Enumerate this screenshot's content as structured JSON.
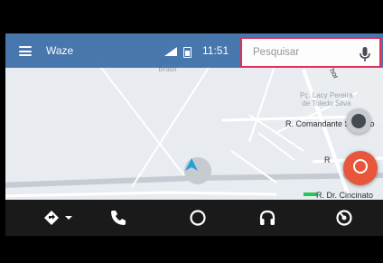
{
  "app": {
    "title": "Waze",
    "time": "11:51"
  },
  "search": {
    "placeholder": "Pesquisar"
  },
  "map": {
    "labels": {
      "toyota": "Toyota do\nBrasil",
      "plaza": "Pç. Lacy Pereira\nde Toledo Silva",
      "comandante": "R. Comandante Salgado",
      "rua_partial": "R",
      "rua_suffix": "ce",
      "cincinato": "R. Dr. Cincinato",
      "rua_top": "hor"
    }
  },
  "icons": {
    "menu": "menu-icon",
    "signal": "cell-signal-icon",
    "battery": "battery-icon",
    "mic": "mic-icon",
    "compass": "compass-icon",
    "report": "report-icon",
    "location": "current-location-arrow-icon",
    "nav": "navigation-icon",
    "phone": "phone-icon",
    "home": "home-icon",
    "audio": "headphones-icon",
    "notifications": "notifications-icon"
  },
  "colors": {
    "topbar": "#3a6ea8",
    "search_border": "#e0204b",
    "report": "#e8563b",
    "navbar": "#1a1a1a",
    "location": "#1fa3d8"
  }
}
